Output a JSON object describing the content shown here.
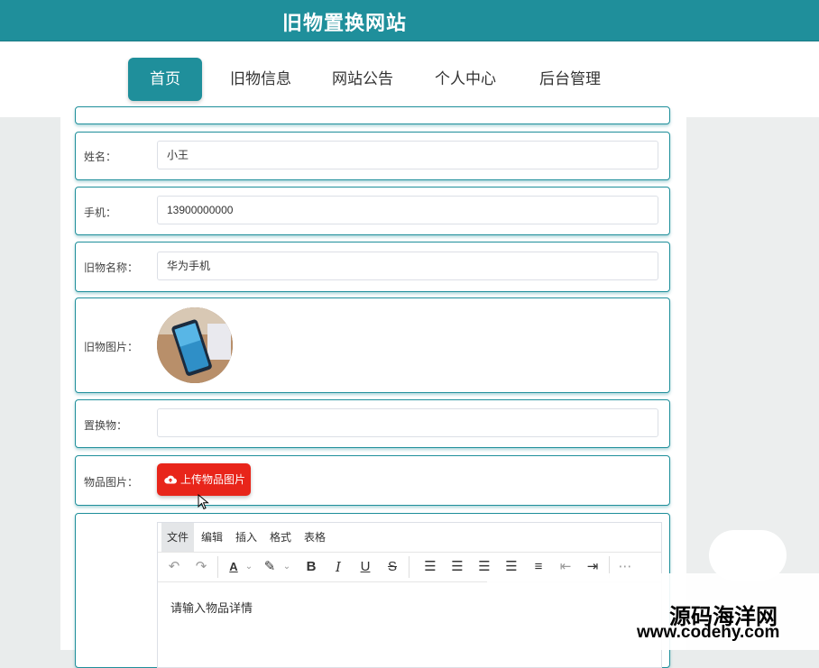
{
  "header": {
    "site_title": "旧物置换网站"
  },
  "nav": {
    "items": [
      {
        "label": "首页",
        "active": true
      },
      {
        "label": "旧物信息"
      },
      {
        "label": "网站公告"
      },
      {
        "label": "个人中心"
      },
      {
        "label": "后台管理"
      }
    ]
  },
  "form": {
    "name": {
      "label": "姓名：",
      "value": "小王"
    },
    "phone": {
      "label": "手机：",
      "value": "13900000000"
    },
    "item_name": {
      "label": "旧物名称：",
      "value": "华为手机"
    },
    "item_image": {
      "label": "旧物图片："
    },
    "exchange_item": {
      "label": "置换物：",
      "value": ""
    },
    "goods_image": {
      "label": "物品图片：",
      "upload_label": "上传物品图片"
    },
    "editor": {
      "menu": [
        "文件",
        "编辑",
        "插入",
        "格式",
        "表格"
      ],
      "placeholder": "请输入物品详情"
    }
  },
  "colors": {
    "primary": "#1f8f9b",
    "upload": "#e8251a"
  },
  "watermark": {
    "title": "源码海洋网",
    "url": "www.codehy.com"
  }
}
